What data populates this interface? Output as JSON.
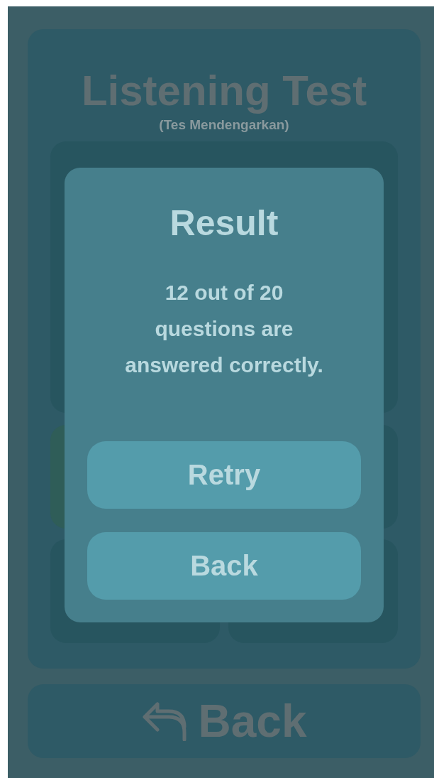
{
  "screen": {
    "title": "Listening Test",
    "subtitle": "(Tes Mendengarkan)",
    "back_button": "Back"
  },
  "dialog": {
    "title": "Result",
    "message": "12 out of 20 questions are answered correctly.",
    "buttons": [
      "Retry",
      "Back"
    ]
  }
}
